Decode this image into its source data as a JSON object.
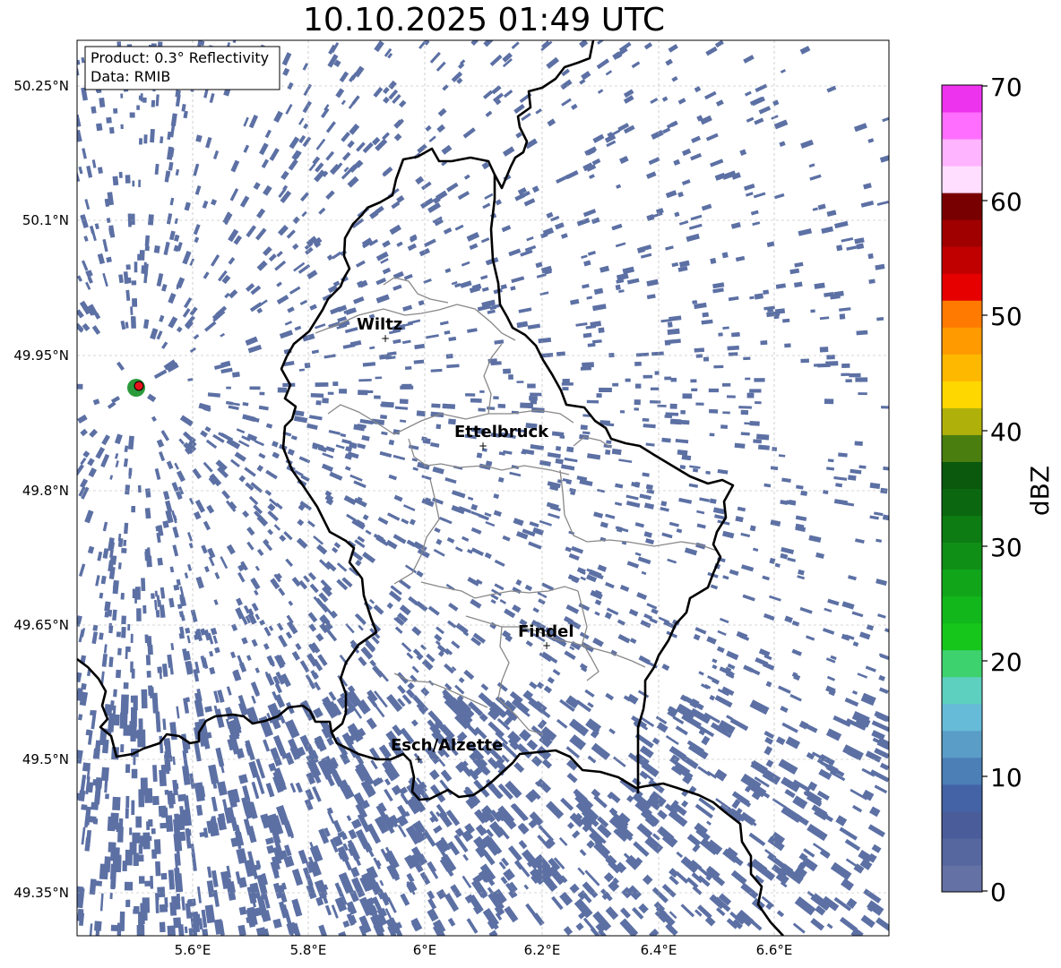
{
  "title": "10.10.2025 01:49 UTC",
  "info_box": {
    "product": "Product: 0.3° Reflectivity",
    "data_source": "Data: RMIB"
  },
  "axes": {
    "lat_ticks": [
      "50.25°N",
      "50.1°N",
      "49.95°N",
      "49.8°N",
      "49.65°N",
      "49.5°N",
      "49.35°N"
    ],
    "lon_ticks": [
      "5.6°E",
      "5.8°E",
      "6°E",
      "6.2°E",
      "6.4°E",
      "6.6°E"
    ]
  },
  "cities": [
    {
      "name": "Wiltz"
    },
    {
      "name": "Ettelbruck"
    },
    {
      "name": "Findel"
    },
    {
      "name": "Esch/Alzette"
    }
  ],
  "colorbar": {
    "title": "dBZ",
    "tick_labels": [
      "0",
      "10",
      "20",
      "30",
      "40",
      "50",
      "60",
      "70"
    ],
    "colors": [
      "#6371a5",
      "#56669f",
      "#4a5d9a",
      "#4463a7",
      "#4b7fb6",
      "#5a9dc7",
      "#66bbd8",
      "#5ed0c0",
      "#3dd26e",
      "#16c61b",
      "#12b71b",
      "#11a61a",
      "#108f17",
      "#0d7c13",
      "#0b6810",
      "#0a590d",
      "#4a7f10",
      "#afb10a",
      "#ffd700",
      "#ffb800",
      "#ff9a00",
      "#ff7a00",
      "#e60000",
      "#c00000",
      "#a00000",
      "#780000",
      "#ffdeff",
      "#ffb4ff",
      "#ff6eff",
      "#ee33ee"
    ]
  },
  "style": {
    "echo_color": "#5c70a4",
    "border_color": "#000000",
    "canton_color": "#888888",
    "radar_site_color": "#e8141c",
    "radar_site_ring": "#2a9a3a"
  }
}
